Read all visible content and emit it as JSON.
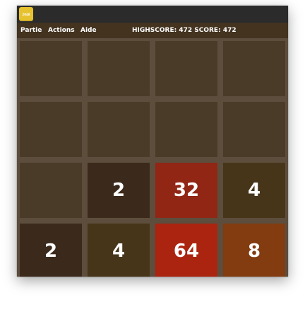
{
  "window": {
    "app_icon_text": "2048"
  },
  "menu": {
    "items": [
      "Partie",
      "Actions",
      "Aide"
    ],
    "score_line": "HIGHSCORE: 472 SCORE: 472",
    "highscore": 472,
    "score": 472
  },
  "board": {
    "rows": [
      [
        "",
        "",
        "",
        ""
      ],
      [
        "",
        "",
        "",
        ""
      ],
      [
        "",
        "2",
        "32",
        "4"
      ],
      [
        "2",
        "4",
        "64",
        "8"
      ]
    ]
  },
  "colors": {
    "background": "#5d4d3c",
    "empty_tile": "#4a3b28",
    "tile_2": "#3b2a1c",
    "tile_4": "#463519",
    "tile_8": "#833b10",
    "tile_32": "#912615",
    "tile_64": "#ab2410",
    "menubar": "#43331f",
    "titlebar": "#2b2b2b",
    "app_icon": "#e7c22f"
  }
}
